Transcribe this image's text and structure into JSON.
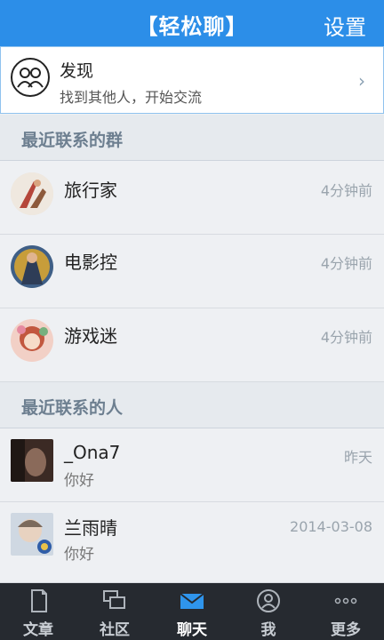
{
  "header": {
    "title": "【轻松聊】",
    "settings_label": "设置"
  },
  "discover": {
    "title": "发现",
    "subtitle": "找到其他人，开始交流",
    "icon": "people-circle-icon",
    "chevron": "›"
  },
  "sections": {
    "groups_title": "最近联系的群",
    "people_title": "最近联系的人"
  },
  "groups": [
    {
      "name": "旅行家",
      "time": "4分钟前"
    },
    {
      "name": "电影控",
      "time": "4分钟前"
    },
    {
      "name": "游戏迷",
      "time": "4分钟前"
    }
  ],
  "people": [
    {
      "name": "_Ona7",
      "message": "你好",
      "time": "昨天"
    },
    {
      "name": "兰雨晴",
      "message": "你好",
      "time": "2014-03-08"
    }
  ],
  "tabs": [
    {
      "label": "文章",
      "icon": "document-icon"
    },
    {
      "label": "社区",
      "icon": "chat-bubbles-icon"
    },
    {
      "label": "聊天",
      "icon": "envelope-icon",
      "active": true
    },
    {
      "label": "我",
      "icon": "user-icon"
    },
    {
      "label": "更多",
      "icon": "more-dots-icon"
    }
  ],
  "colors": {
    "header": "#2c8ee8",
    "tabbar": "#262a30",
    "active_icon": "#2f95ec"
  }
}
